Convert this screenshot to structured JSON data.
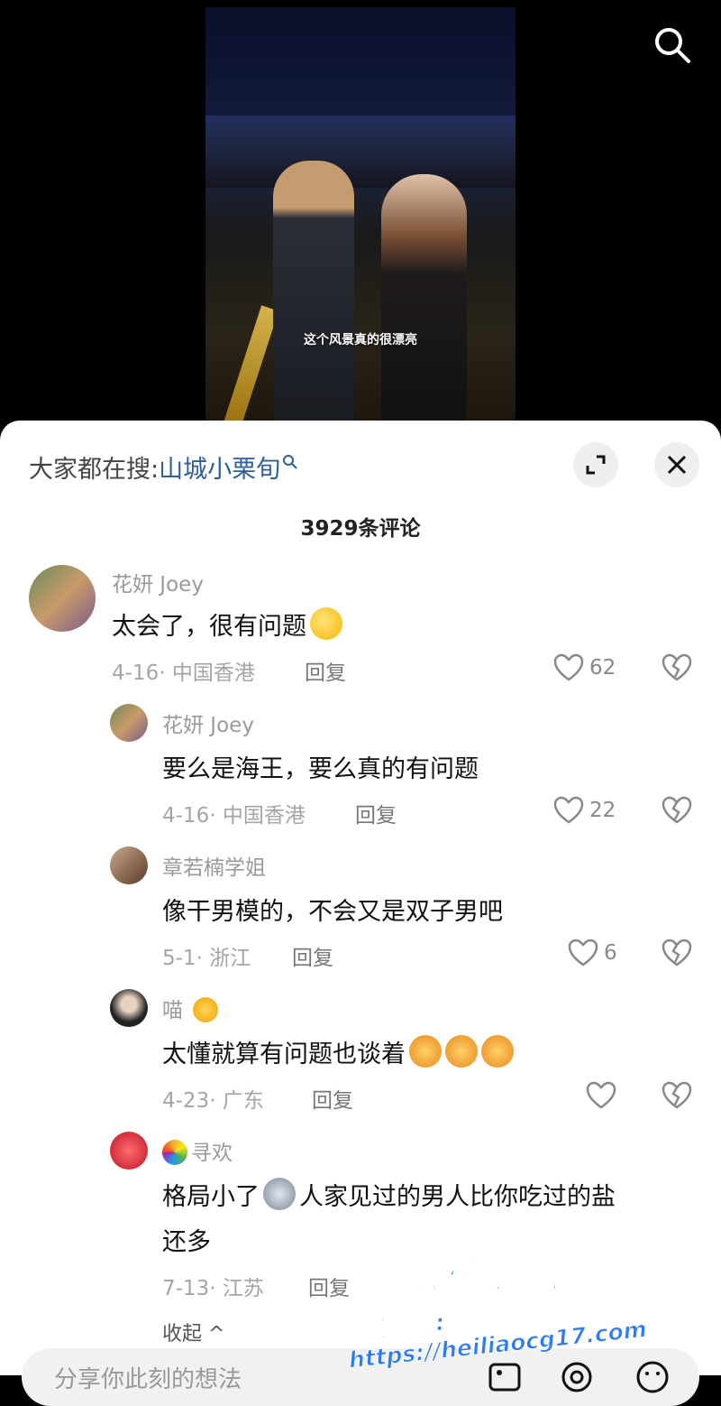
{
  "video": {
    "subtitle": "这个风景真的很漂亮"
  },
  "sheet": {
    "hot_prefix": "大家都在搜:",
    "hot_keyword": "山城小栗旬",
    "comment_count": "3929条评论",
    "collapse_label": "收起 ^",
    "input_placeholder": "分享你此刻的想法"
  },
  "comments": [
    {
      "name": "花妍 Joey",
      "text": "太会了，很有问题",
      "meta": "4-16· 中国香港",
      "reply": "回复",
      "likes": "62"
    },
    {
      "name": "花妍 Joey",
      "text": "要么是海王，要么真的有问题",
      "meta": "4-16· 中国香港",
      "reply": "回复",
      "likes": "22"
    },
    {
      "name": "章若楠学姐",
      "text": "像干男模的，不会又是双子男吧",
      "meta": "5-1· 浙江",
      "reply": "回复",
      "likes": "6"
    },
    {
      "name": "喵",
      "text": "太懂就算有问题也谈着",
      "meta": "4-23· 广东",
      "reply": "回复",
      "likes": ""
    },
    {
      "name": "寻欢",
      "text_line1": "格局小了",
      "text_line1b": "人家见过的男人比你吃过的盐",
      "text_line2": "还多",
      "meta": "7-13· 江苏",
      "reply": "回复",
      "likes": ""
    }
  ],
  "watermark": {
    "line1": "黑料吃瓜网",
    "line2": "看完整版: https://heiliaocg17.com"
  },
  "colors": {
    "keyword": "#2e5f9a",
    "sheet_bg": "#ffffff",
    "watermark": "#2c7bff"
  }
}
